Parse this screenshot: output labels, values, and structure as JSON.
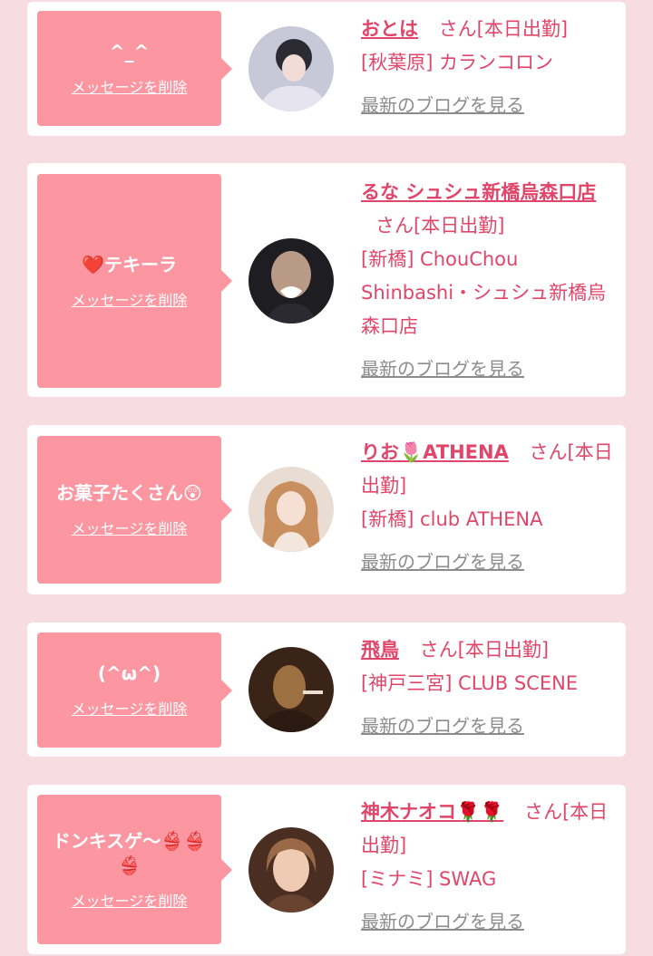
{
  "colors": {
    "background": "#f7dde2",
    "bubble": "#fc96a1",
    "accent": "#e0466a",
    "muted": "#8c8c8c"
  },
  "cards": [
    {
      "message": "^_^",
      "delete_label": "メッセージを削除",
      "name": "おとは",
      "suffix": "さん[本日出勤]",
      "shop": "[秋葉原] カランコロン",
      "blog_label": "最新のブログを見る"
    },
    {
      "message": "❤️テキーラ",
      "delete_label": "メッセージを削除",
      "name": "るな シュシュ新橋烏森口店",
      "suffix": "さん[本日出勤]",
      "shop": "[新橋] ChouChou Shinbashi・シュシュ新橋烏森口店",
      "blog_label": "最新のブログを見る"
    },
    {
      "message": "お菓子たくさん😲",
      "delete_label": "メッセージを削除",
      "name": "りお🌷ATHENA",
      "suffix": "さん[本日出勤]",
      "shop": "[新橋] club ATHENA",
      "blog_label": "最新のブログを見る"
    },
    {
      "message": "(^ω^)",
      "delete_label": "メッセージを削除",
      "name": "飛鳥",
      "suffix": "さん[本日出勤]",
      "shop": "[神戸三宮] CLUB SCENE",
      "blog_label": "最新のブログを見る"
    },
    {
      "message": "ドンキスゲ〜👙👙👙",
      "delete_label": "メッセージを削除",
      "name": "神木ナオコ🌹🌹",
      "suffix": "さん[本日出勤]",
      "shop": "[ミナミ] SWAG",
      "blog_label": "最新のブログを見る"
    }
  ]
}
